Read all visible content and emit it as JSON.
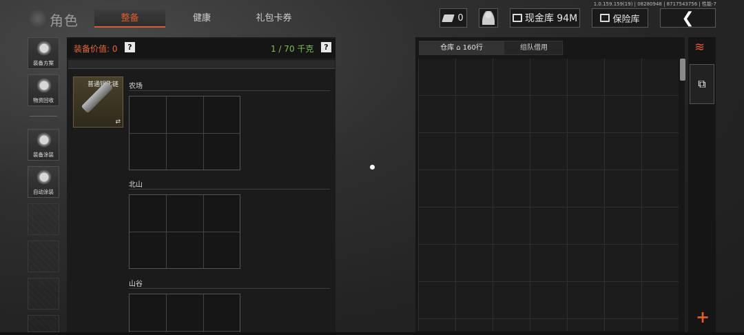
{
  "version_text": "1.0.159.159(19) | 08280948 | 8717543756 | 性能-7",
  "header": {
    "title": "角色",
    "tabs": [
      {
        "label": "整备",
        "active": true
      },
      {
        "label": "健康",
        "active": false
      },
      {
        "label": "礼包卡券",
        "active": false
      }
    ],
    "ticket_count": "0",
    "cash_label": "现金库 94M",
    "vault_label": "保险库",
    "back_icon": "❮"
  },
  "sidebar": {
    "items": [
      {
        "label": "装备方案",
        "icon": "gear-loadout-icon"
      },
      {
        "label": "物资回收",
        "icon": "recycle-icon"
      },
      {
        "label": "装备涂装",
        "icon": "helmet-paint-icon"
      },
      {
        "label": "自动涂装",
        "icon": "spray-icon"
      }
    ]
  },
  "equipment": {
    "value_label": "装备价值: 0",
    "weight_label": "1 / 70 千克",
    "help_symbol": "?",
    "key_item": "普通钥匙链",
    "swap_symbol": "⇄",
    "sections": [
      {
        "title": "农场"
      },
      {
        "title": "北山"
      },
      {
        "title": "山谷"
      }
    ]
  },
  "warehouse": {
    "tab_storage": "仓库 ⌂ 160行",
    "tab_team": "组队借用",
    "sort_icon": "≋",
    "stack_icon": "⧉",
    "add_icon": "+"
  },
  "colors": {
    "accent": "#e05a2b",
    "weight_green": "#7fc24a",
    "value_orange": "#e46a35"
  }
}
